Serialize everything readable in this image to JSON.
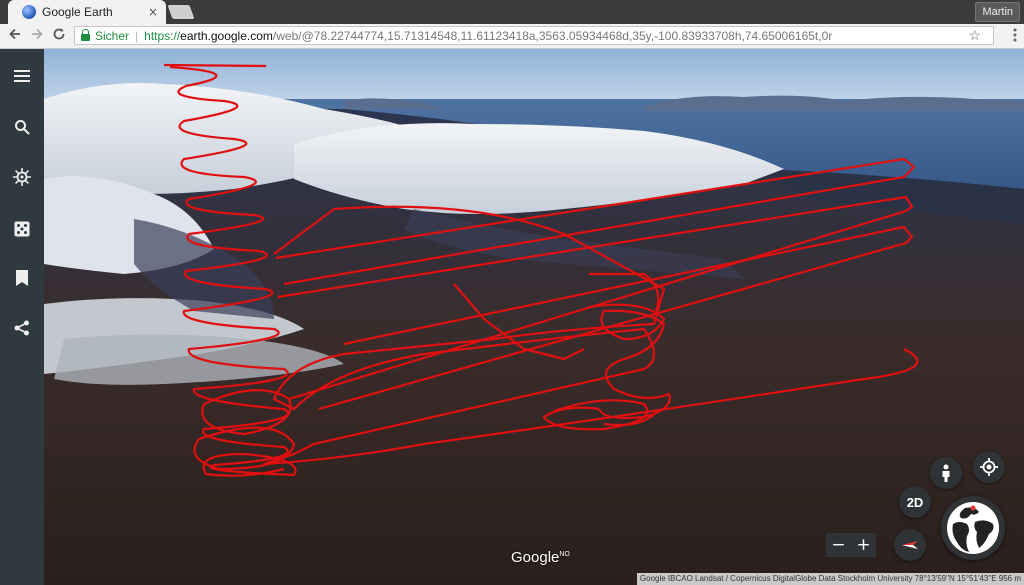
{
  "browser": {
    "tab_title": "Google Earth",
    "tab_close": "×",
    "profile_name": "Martin",
    "back_icon": "back-arrow-icon",
    "forward_icon": "forward-arrow-icon",
    "reload_icon": "reload-icon",
    "secure_label": "Sicher",
    "url_scheme": "https://",
    "url_host": "earth.google.com",
    "url_path": "/web/@78.22744774,15.71314548,11.61123418a,3563.05934468d,35y,-100.83933708h,74.65006165t,0r"
  },
  "sidebar": {
    "items": [
      {
        "name": "menu-icon"
      },
      {
        "name": "search-icon"
      },
      {
        "name": "voyager-icon"
      },
      {
        "name": "feeling-lucky-icon"
      },
      {
        "name": "projects-icon"
      },
      {
        "name": "share-icon"
      }
    ]
  },
  "controls": {
    "pegman_icon": "pegman-icon",
    "locate_icon": "my-location-icon",
    "view_2d_label": "2D",
    "zoom_out_label": "−",
    "zoom_in_label": "+",
    "compass_icon": "compass-icon",
    "globe_icon": "globe-minimap-icon"
  },
  "map": {
    "logo": "Google",
    "logo_sup": "NO",
    "attribution": "Google   IBCAO   Landsat / Copernicus   DigitalGlobe   Data Stockholm University     78°13'59\"N 15°51'43\"E   956 m",
    "track_color": "#e01010"
  }
}
